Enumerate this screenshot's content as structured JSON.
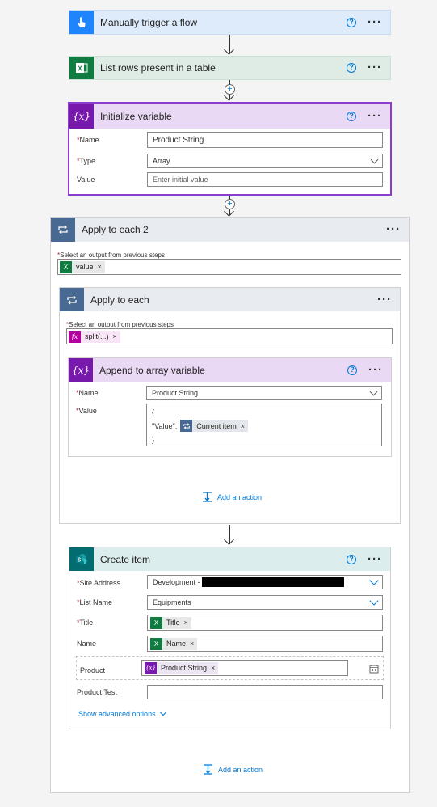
{
  "colors": {
    "trigger_bg": "#ddebfb",
    "excel_bg": "#dfece6",
    "variable_bg": "#ead9f5",
    "loop_bg": "#e8ebf0",
    "sharepoint_bg": "#dcedee",
    "link_blue": "#0078d4"
  },
  "trigger": {
    "title": "Manually trigger a flow",
    "icon": "touch-icon"
  },
  "list_rows": {
    "title": "List rows present in a table",
    "icon": "excel-icon"
  },
  "init_var": {
    "title": "Initialize variable",
    "icon": "variable-icon",
    "name_label": "Name",
    "name_value": "Product String",
    "type_label": "Type",
    "type_value": "Array",
    "value_label": "Value",
    "value_placeholder": "Enter initial value"
  },
  "apply2": {
    "title": "Apply to each 2",
    "select_label": "Select an output from previous steps",
    "token": "value"
  },
  "apply1": {
    "title": "Apply to each",
    "select_label": "Select an output from previous steps",
    "token": "split(...)"
  },
  "append": {
    "title": "Append to array variable",
    "name_label": "Name",
    "name_value": "Product String",
    "value_label": "Value",
    "line1": "{",
    "line2_key": "\"Value\":",
    "token": "Current item",
    "line3": "}"
  },
  "inner_add_action": "Add an action",
  "create_item": {
    "title": "Create item",
    "site_label": "Site Address",
    "site_value": "Development -",
    "list_label": "List Name",
    "list_value": "Equipments",
    "title_label": "Title",
    "title_token": "Title",
    "name_label": "Name",
    "name_token": "Name",
    "product_label": "Product",
    "product_token": "Product String",
    "product_test_label": "Product Test",
    "advanced": "Show advanced options"
  },
  "outer_add_action": "Add an action",
  "common": {
    "more": "···",
    "help": "?",
    "remove": "×",
    "required": "*"
  }
}
